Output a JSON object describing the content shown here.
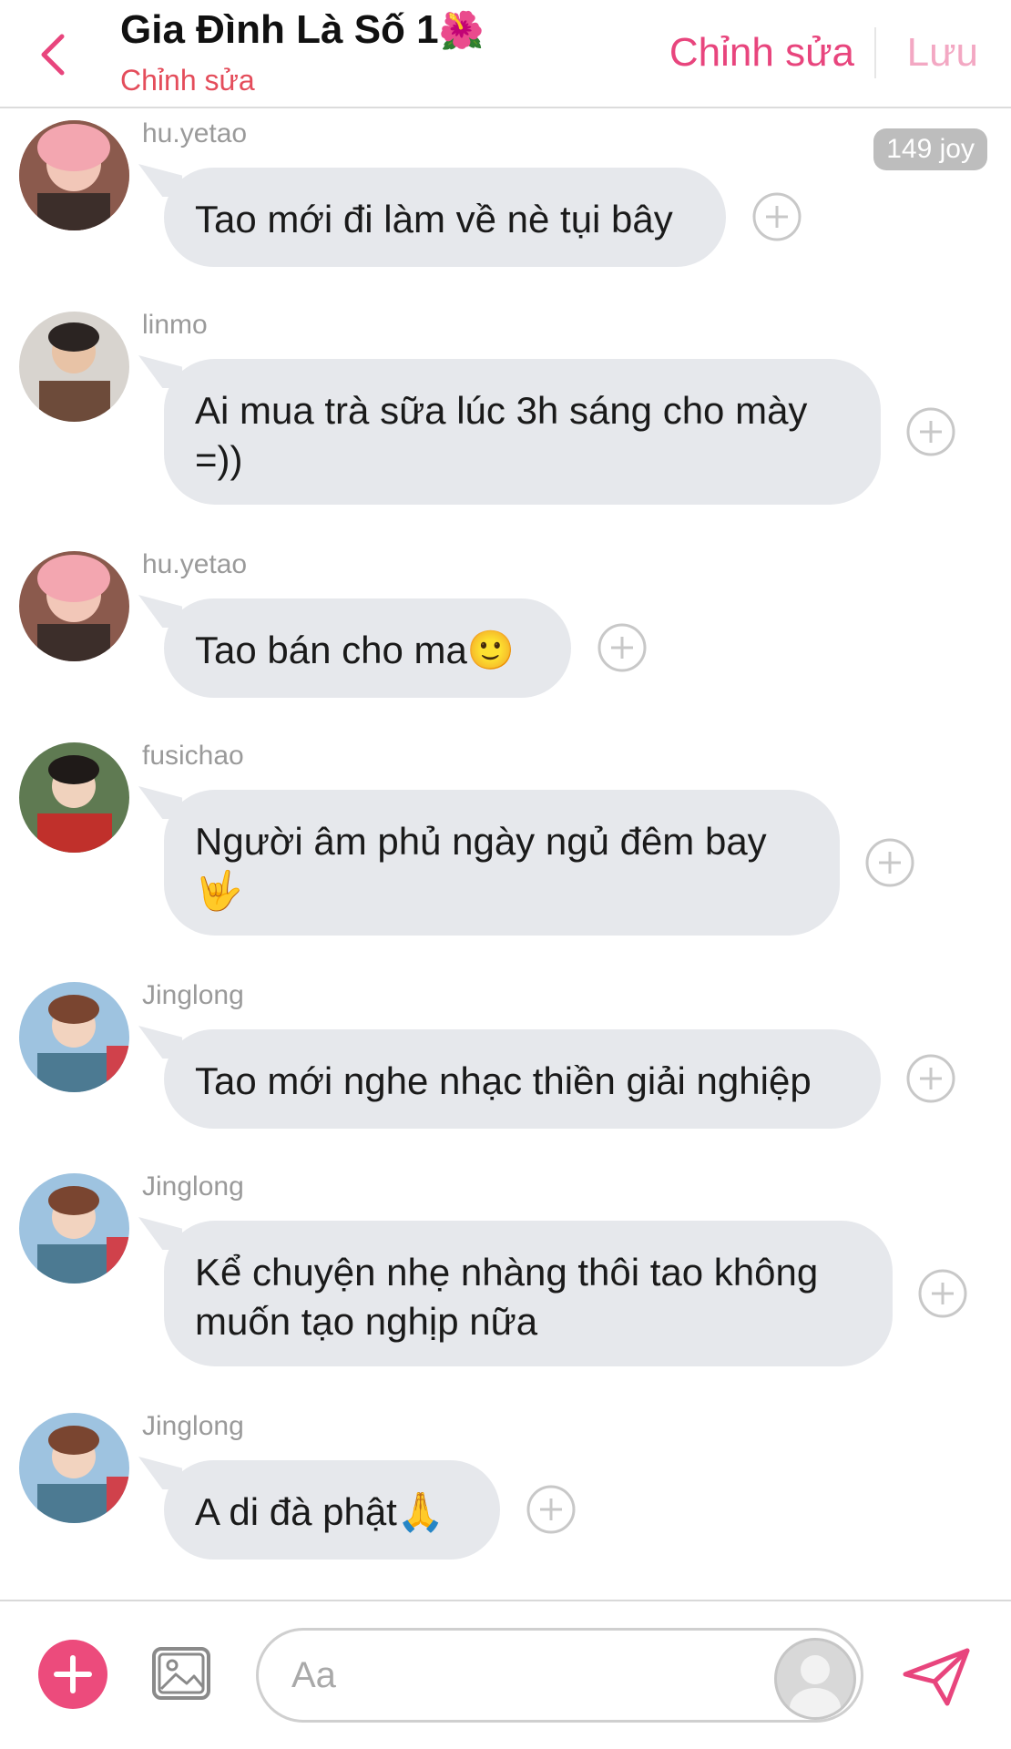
{
  "header": {
    "title": "Gia Đình Là Số 1",
    "title_emoji": "🌺",
    "subtitle": "Chỉnh sửa",
    "edit_label": "Chỉnh sửa",
    "save_label": "Lưu",
    "joy_badge": "149 joy"
  },
  "messages": [
    {
      "user": "hu.yetao",
      "text": "Tao mới đi làm về nè tụi bây",
      "avatar_color": "#c07a6c"
    },
    {
      "user": "linmo",
      "text": "Ai mua trà sữa lúc 3h sáng cho mày =))",
      "avatar_color": "#6d5a4e"
    },
    {
      "user": "hu.yetao",
      "text": "Tao bán cho ma🙂",
      "avatar_color": "#c07a6c"
    },
    {
      "user": "fusichao",
      "text": "Người âm phủ ngày ngủ đêm bay 🤟",
      "avatar_color": "#b83a33"
    },
    {
      "user": "Jinglong",
      "text": "Tao mới nghe nhạc thiền giải nghiệp",
      "avatar_color": "#6e9abf"
    },
    {
      "user": "Jinglong",
      "text": "Kể chuyện nhẹ nhàng thôi tao không muốn tạo nghịp nữa",
      "avatar_color": "#6e9abf"
    },
    {
      "user": "Jinglong",
      "text": "A di đà phật🙏",
      "avatar_color": "#6e9abf"
    }
  ],
  "composer": {
    "placeholder": "Aa"
  },
  "colors": {
    "accent": "#ec4b7c",
    "bubble": "#e6e8ec",
    "subtitle": "#e44d5b"
  },
  "icons": [
    "back-chevron-icon",
    "plus-circle-icon",
    "image-icon",
    "profile-icon",
    "send-icon"
  ]
}
